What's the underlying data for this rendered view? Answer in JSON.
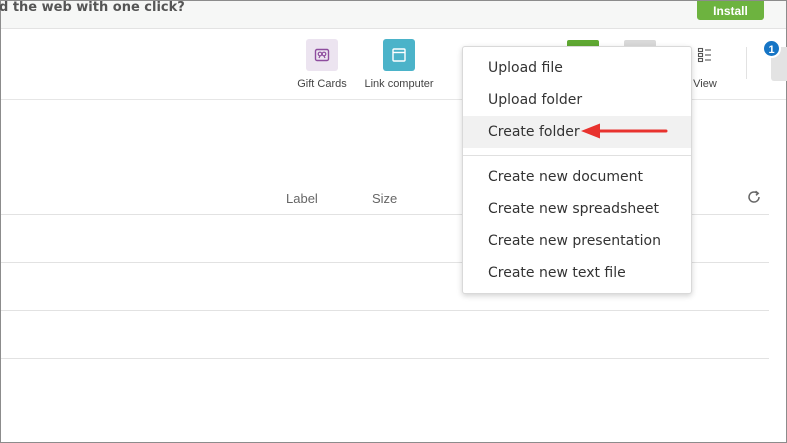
{
  "banner": {
    "text": "d the web with one click?",
    "install_label": "Install"
  },
  "toolbar": {
    "gift_cards_label": "Gift Cards",
    "link_computer_label": "Link computer",
    "view_label": "View",
    "notification_count": "1"
  },
  "list": {
    "columns": [
      "Label",
      "Size"
    ]
  },
  "menu": {
    "items": [
      "Upload file",
      "Upload folder",
      "Create folder",
      "Create new document",
      "Create new spreadsheet",
      "Create new presentation",
      "Create new text file"
    ],
    "highlighted": "Create folder"
  },
  "colors": {
    "install_green": "#6db33f",
    "link_teal": "#4bb3c9",
    "badge_blue": "#1675c5",
    "arrow_red": "#e8322e"
  }
}
